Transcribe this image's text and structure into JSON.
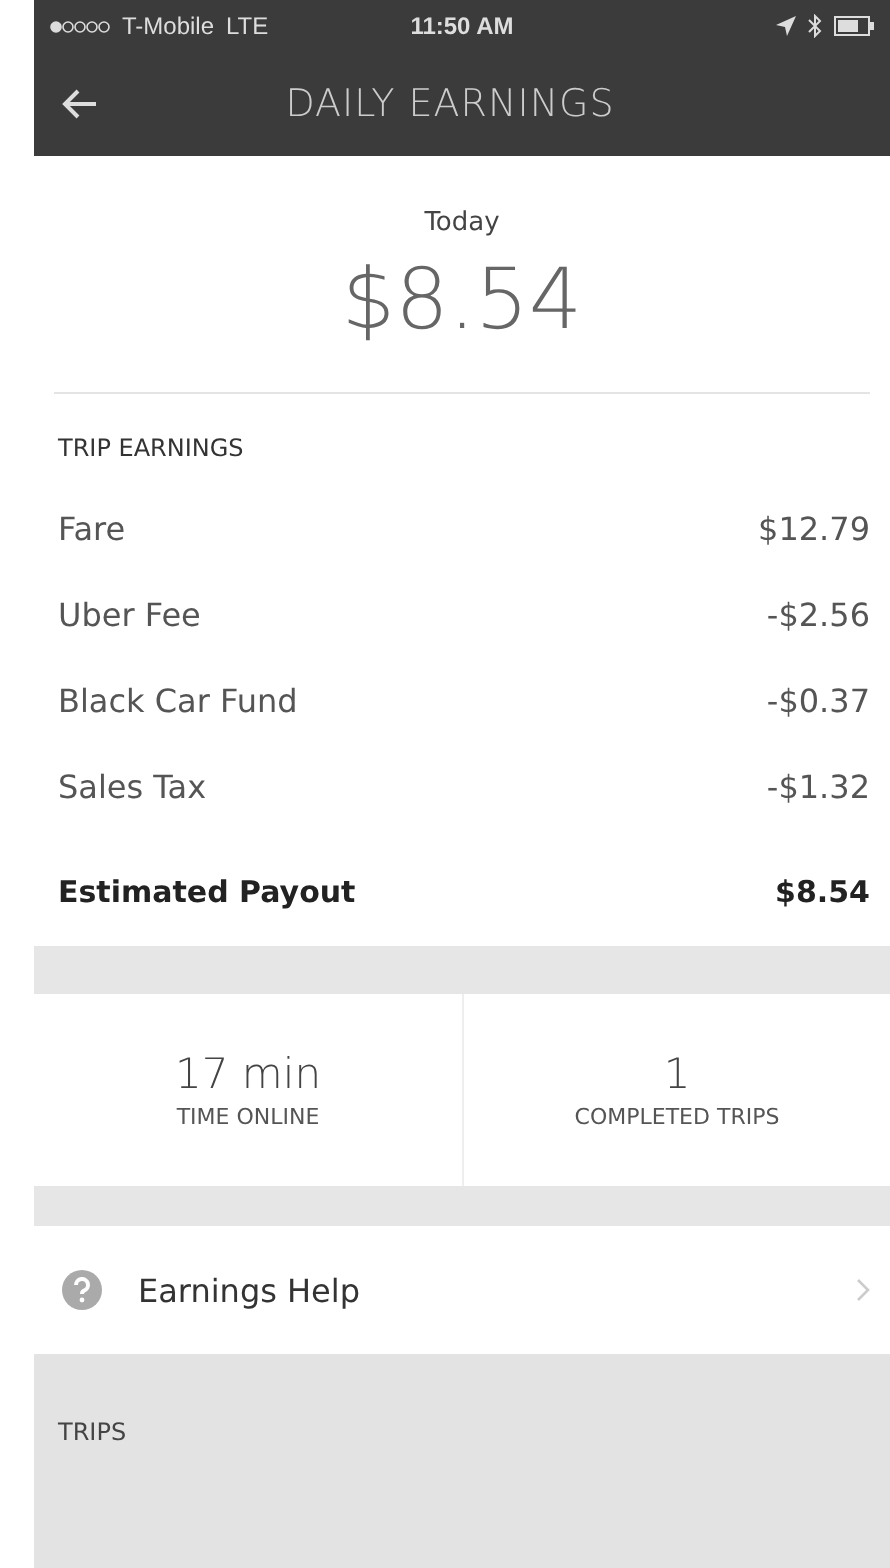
{
  "status_bar": {
    "carrier": "T-Mobile",
    "network": "LTE",
    "time": "11:50 AM"
  },
  "header": {
    "title": "DAILY EARNINGS"
  },
  "summary": {
    "label": "Today",
    "amount": "$8.54"
  },
  "trip_earnings": {
    "heading": "TRIP EARNINGS",
    "rows": [
      {
        "label": "Fare",
        "value": "$12.79"
      },
      {
        "label": "Uber Fee",
        "value": "-$2.56"
      },
      {
        "label": "Black Car Fund",
        "value": "-$0.37"
      },
      {
        "label": "Sales Tax",
        "value": "-$1.32"
      }
    ],
    "total": {
      "label": "Estimated Payout",
      "value": "$8.54"
    }
  },
  "stats": [
    {
      "value": "17 min",
      "label": "TIME ONLINE"
    },
    {
      "value": "1",
      "label": "COMPLETED TRIPS"
    }
  ],
  "help": {
    "label": "Earnings Help"
  },
  "trips": {
    "heading": "TRIPS"
  }
}
